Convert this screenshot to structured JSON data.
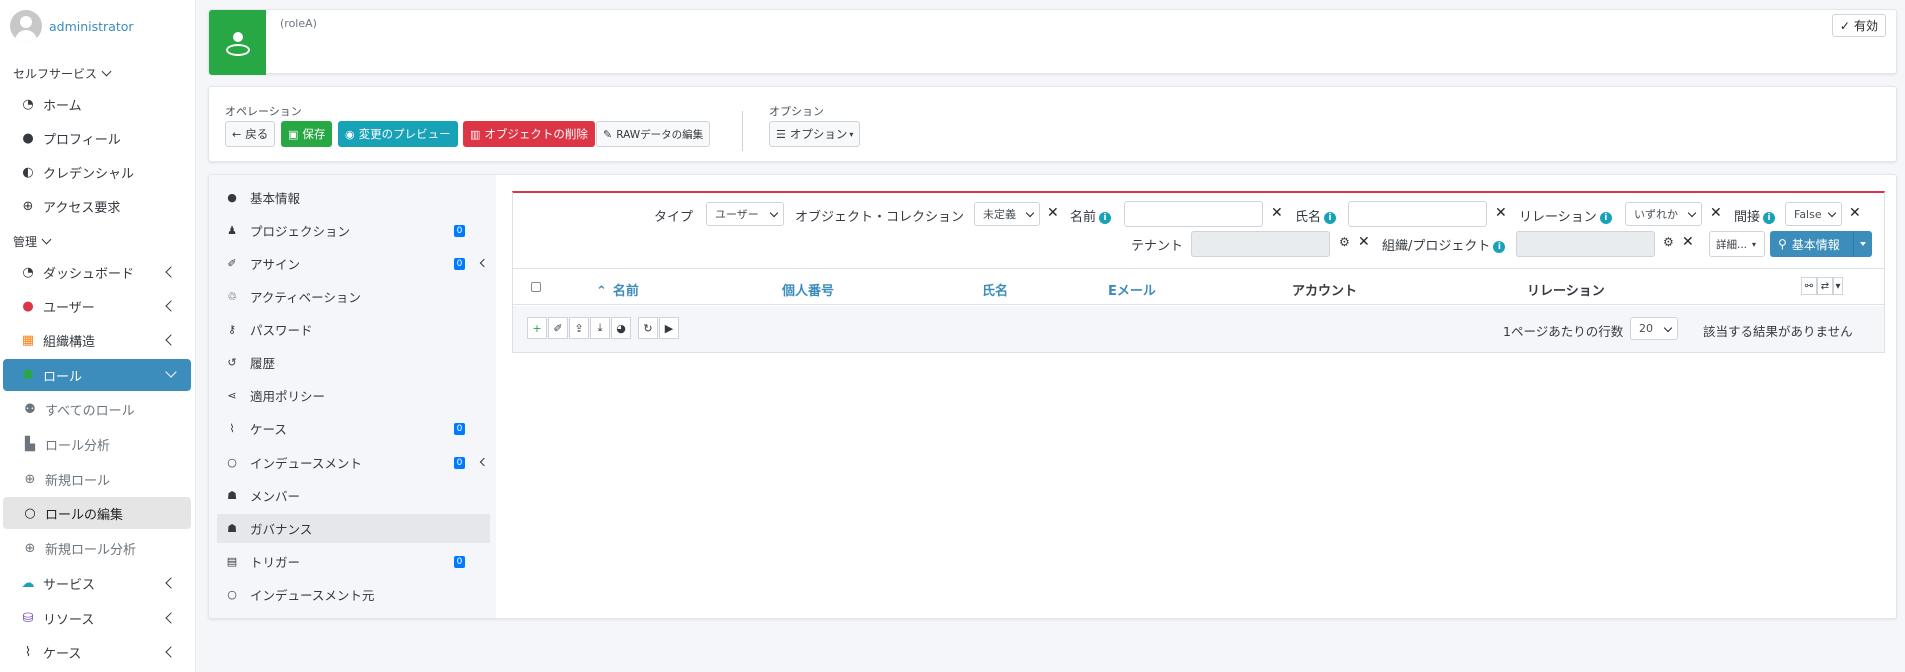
{
  "user": {
    "name": "administrator"
  },
  "sidebar": {
    "self_service_header": "セルフサービス",
    "self_service": [
      {
        "label": "ホーム",
        "icon": "dashboard-icon"
      },
      {
        "label": "プロフィール",
        "icon": "user-icon"
      },
      {
        "label": "クレデンシャル",
        "icon": "shield-icon"
      },
      {
        "label": "アクセス要求",
        "icon": "plus-circle-icon"
      }
    ],
    "admin_header": "管理",
    "admin": [
      {
        "label": "ダッシュボード",
        "icon": "dashboard-icon"
      },
      {
        "label": "ユーザー",
        "icon": "user-icon"
      },
      {
        "label": "組織構造",
        "icon": "building-icon"
      },
      {
        "label": "ロール",
        "icon": "role-icon"
      },
      {
        "label": "すべてのロール",
        "icon": "role-icon"
      },
      {
        "label": "ロール分析",
        "icon": "chart-icon"
      },
      {
        "label": "新規ロール",
        "icon": "plus-circle-icon"
      },
      {
        "label": "ロールの編集",
        "icon": "circle-icon"
      },
      {
        "label": "新規ロール分析",
        "icon": "plus-circle-icon"
      },
      {
        "label": "サービス",
        "icon": "cloud-icon"
      },
      {
        "label": "リソース",
        "icon": "database-icon"
      },
      {
        "label": "ケース",
        "icon": "case-icon"
      }
    ]
  },
  "header": {
    "role_name": "(roleA)",
    "status": "有効"
  },
  "operations": {
    "label": "オペレーション",
    "back": "戻る",
    "save": "保存",
    "preview": "変更のプレビュー",
    "delete": "オブジェクトの削除",
    "raw_edit": "RAWデータの編集",
    "options_label": "オプション",
    "options": "オプション"
  },
  "submenu": [
    {
      "label": "基本情報",
      "icon": "circle-filled-icon"
    },
    {
      "label": "プロジェクション",
      "icon": "person-icon",
      "badge": "0"
    },
    {
      "label": "アサイン",
      "icon": "assign-icon",
      "badge": "0"
    },
    {
      "label": "アクティベーション",
      "icon": "recycle-icon"
    },
    {
      "label": "パスワード",
      "icon": "key-icon"
    },
    {
      "label": "履歴",
      "icon": "history-icon"
    },
    {
      "label": "適用ポリシー",
      "icon": "share-icon"
    },
    {
      "label": "ケース",
      "icon": "case-icon",
      "badge": "0"
    },
    {
      "label": "インデュースメント",
      "icon": "circle-icon",
      "badge": "0"
    },
    {
      "label": "メンバー",
      "icon": "users-icon"
    },
    {
      "label": "ガバナンス",
      "icon": "users-icon"
    },
    {
      "label": "トリガー",
      "icon": "calendar-icon",
      "badge": "0"
    },
    {
      "label": "インデュースメント元",
      "icon": "circle-icon"
    }
  ],
  "search": {
    "type_label": "タイプ",
    "type_value": "ユーザー",
    "collection_label": "オブジェクト・コレクション",
    "collection_value": "未定義",
    "name_label": "名前",
    "fullname_label": "氏名",
    "relation_label": "リレーション",
    "relation_value": "いずれか",
    "indirect_label": "間接",
    "indirect_value": "False",
    "tenant_label": "テナント",
    "org_label": "組織/プロジェクト",
    "more": "詳細...",
    "search_button": "基本情報"
  },
  "table": {
    "columns": [
      "名前",
      "個人番号",
      "氏名",
      "Eメール",
      "アカウント",
      "リレーション"
    ],
    "rows_per_page_label": "1ページあたりの行数",
    "rows_per_page": "20",
    "empty": "該当する結果がありません"
  }
}
